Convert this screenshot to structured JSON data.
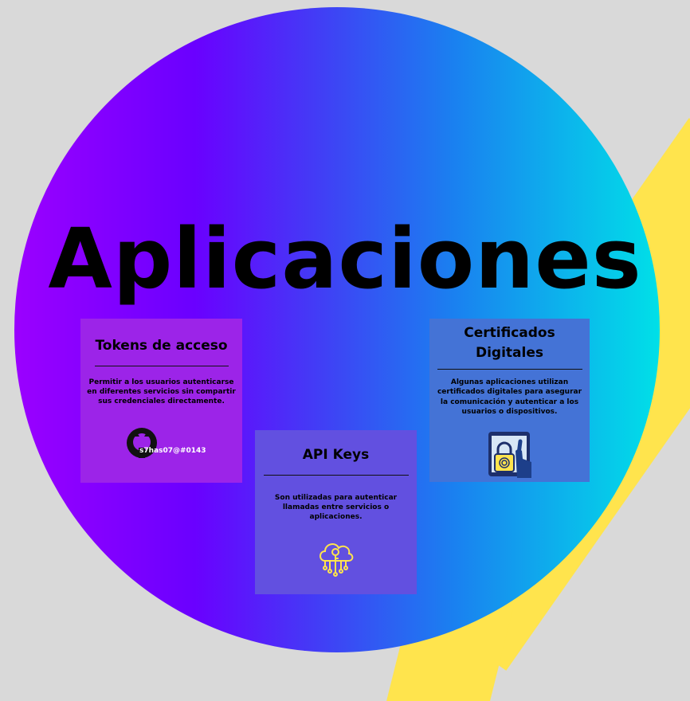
{
  "title": "Aplicaciones",
  "cards": [
    {
      "heading": "Tokens de acceso",
      "description": "Permitir a los usuarios autenticarse en diferentes servicios sin compartir sus credenciales directamente.",
      "icon": "github-icon",
      "handle": "s7has07@#0143"
    },
    {
      "heading": "API Keys",
      "description": "Son utilizadas para autenticar llamadas entre servicios o aplicaciones.",
      "icon": "cloud-key-icon"
    },
    {
      "heading": "Certificados Digitales",
      "description": "Algunas aplicaciones utilizan certificados digitales para asegurar la comunicación y autenticar a los usuarios o dispositivos.",
      "icon": "tablet-lock-icon"
    }
  ],
  "colors": {
    "background": "#d9d9d9",
    "accent_yellow": "#ffe44d",
    "gradient_start": "#9b00ff",
    "gradient_end": "#00e0e8"
  }
}
